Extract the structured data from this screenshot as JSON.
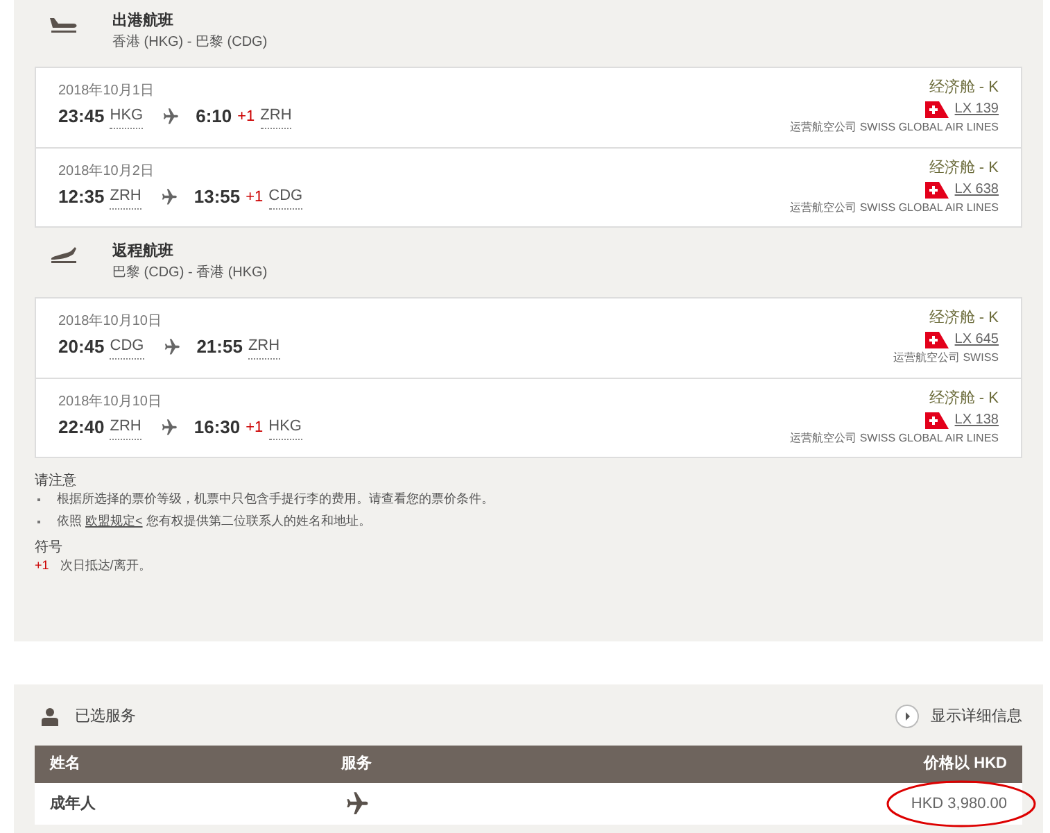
{
  "journeys": [
    {
      "kind": "outbound",
      "title": "出港航班",
      "route": "香港 (HKG) - 巴黎 (CDG)",
      "segments": [
        {
          "date": "2018年10月1日",
          "dep_time": "23:45",
          "dep_code": "HKG",
          "arr_time": "6:10",
          "next_day": "+1",
          "arr_code": "ZRH",
          "cabin": "经济舱 - K",
          "flight": "LX 139",
          "operator": "运营航空公司 SWISS GLOBAL AIR LINES"
        },
        {
          "date": "2018年10月2日",
          "dep_time": "12:35",
          "dep_code": "ZRH",
          "arr_time": "13:55",
          "next_day": "+1",
          "arr_code": "CDG",
          "cabin": "经济舱 - K",
          "flight": "LX 638",
          "operator": "运营航空公司 SWISS GLOBAL AIR LINES"
        }
      ]
    },
    {
      "kind": "return",
      "title": "返程航班",
      "route": "巴黎 (CDG) - 香港 (HKG)",
      "segments": [
        {
          "date": "2018年10月10日",
          "dep_time": "20:45",
          "dep_code": "CDG",
          "arr_time": "21:55",
          "arr_code": "ZRH",
          "cabin": "经济舱 - K",
          "flight": "LX 645",
          "operator": "运营航空公司 SWISS"
        },
        {
          "date": "2018年10月10日",
          "dep_time": "22:40",
          "dep_code": "ZRH",
          "arr_time": "16:30",
          "next_day": "+1",
          "arr_code": "HKG",
          "cabin": "经济舱 - K",
          "flight": "LX 138",
          "operator": "运营航空公司 SWISS GLOBAL AIR LINES"
        }
      ]
    }
  ],
  "notice": {
    "title": "请注意",
    "items": [
      {
        "before": "根据所选择的票价等级，机票中只包含手提行李的费用。请查看您的票价条件。"
      },
      {
        "before": "依照",
        "link": "欧盟规定<",
        "after": "您有权提供第二位联系人的姓名和地址。"
      }
    ]
  },
  "legend": {
    "title": "符号",
    "symbol": "+1",
    "text": "次日抵达/离开。"
  },
  "services": {
    "title": "已选服务",
    "details_link": "显示详细信息",
    "columns": [
      "姓名",
      "服务",
      "价格以 HKD"
    ],
    "rows": [
      {
        "name": "成年人",
        "price": "HKD 3,980.00"
      }
    ],
    "price_circled": true
  }
}
